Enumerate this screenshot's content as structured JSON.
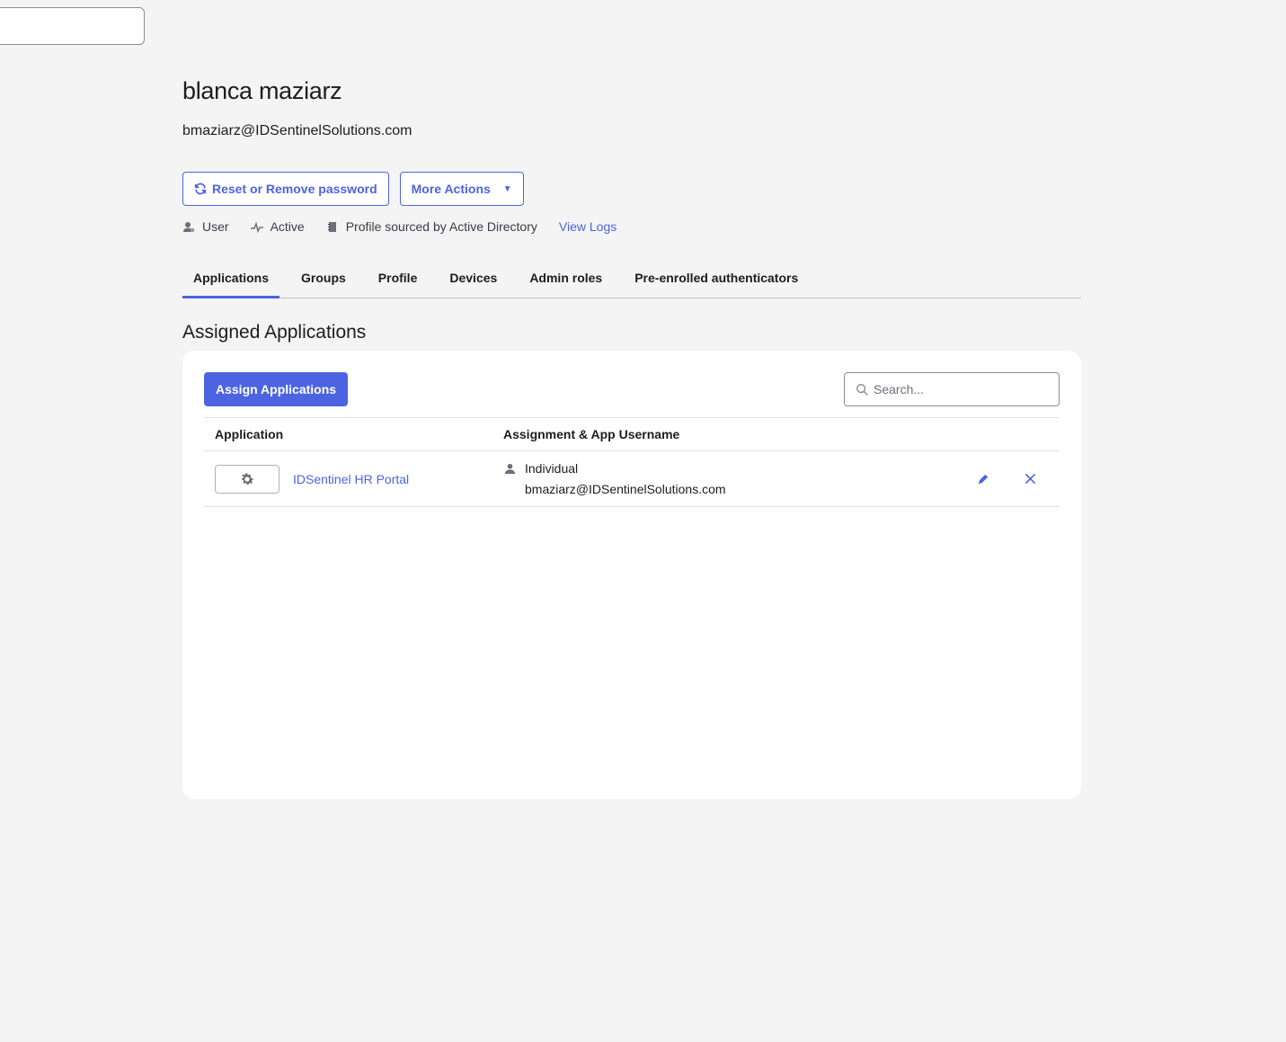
{
  "user": {
    "name": "blanca maziarz",
    "email": "bmaziarz@IDSentinelSolutions.com"
  },
  "actions": {
    "reset_label": "Reset or Remove password",
    "reset_icon": "refresh-icon",
    "more_label": "More Actions",
    "more_icon": "caret-down-icon"
  },
  "meta": {
    "type_label": "User",
    "status_label": "Active",
    "source_label": "Profile sourced by Active Directory",
    "view_logs_label": "View Logs"
  },
  "tabs": [
    {
      "label": "Applications",
      "active": true
    },
    {
      "label": "Groups",
      "active": false
    },
    {
      "label": "Profile",
      "active": false
    },
    {
      "label": "Devices",
      "active": false
    },
    {
      "label": "Admin roles",
      "active": false
    },
    {
      "label": "Pre-enrolled authenticators",
      "active": false
    }
  ],
  "section": {
    "title": "Assigned Applications",
    "assign_button_label": "Assign Applications",
    "search_placeholder": "Search..."
  },
  "table": {
    "headers": {
      "application": "Application",
      "assignment": "Assignment & App Username"
    },
    "rows": [
      {
        "app_name": "IDSentinel HR Portal",
        "app_icon": "gear-icon",
        "assignment_type": "Individual",
        "app_username": "bmaziarz@IDSentinelSolutions.com"
      }
    ]
  },
  "colors": {
    "accent": "#4c64e1",
    "background": "#f4f4f4",
    "card": "#ffffff",
    "text": "#1d1d21"
  }
}
